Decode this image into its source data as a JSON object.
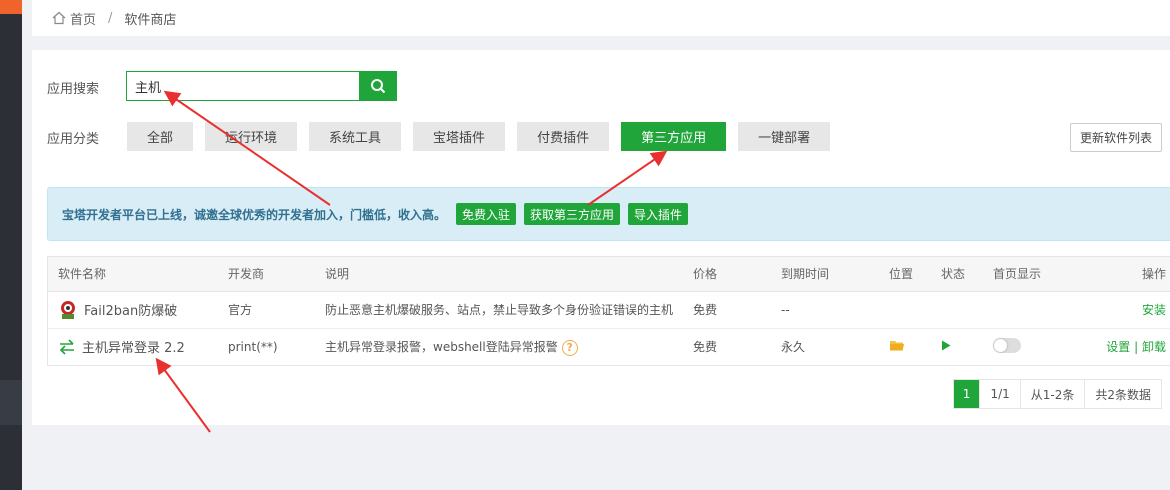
{
  "breadcrumb": {
    "home": "首页",
    "separator": "/",
    "current": "软件商店"
  },
  "search": {
    "label": "应用搜索",
    "value": "主机"
  },
  "categories": {
    "label": "应用分类",
    "items": [
      "全部",
      "运行环境",
      "系统工具",
      "宝塔插件",
      "付费插件",
      "第三方应用",
      "一键部署"
    ],
    "active": "第三方应用"
  },
  "refresh_label": "更新软件列表",
  "notice": {
    "text": "宝塔开发者平台已上线，诚邀全球优秀的开发者加入，门槛低，收入高。",
    "buttons": [
      "免费入驻",
      "获取第三方应用",
      "导入插件"
    ]
  },
  "table": {
    "headers": [
      "软件名称",
      "开发商",
      "说明",
      "价格",
      "到期时间",
      "位置",
      "状态",
      "首页显示",
      "操作"
    ],
    "rows": [
      {
        "name": "Fail2ban防爆破",
        "developer": "官方",
        "description": "防止恶意主机爆破服务、站点，禁止导致多个身份验证错误的主机",
        "price": "免费",
        "expiry": "--",
        "action": "安装"
      },
      {
        "name": "主机异常登录 2.2",
        "developer": "print(**)",
        "description": "主机异常登录报警，webshell登陆异常报警",
        "price": "免费",
        "expiry": "永久",
        "action_set": "设置",
        "action_sep": "|",
        "action_uninstall": "卸载"
      }
    ]
  },
  "pagination": {
    "current": "1",
    "pages": "1/1",
    "range": "从1-2条",
    "total": "共2条数据"
  },
  "colors": {
    "accent": "#20a53a",
    "notice_bg": "#d9edf7",
    "arrow": "#e8312f"
  },
  "icons": [
    "home-icon",
    "search-icon",
    "fail2ban-icon",
    "swap-arrows-icon",
    "folder-icon",
    "play-icon",
    "help-icon"
  ]
}
